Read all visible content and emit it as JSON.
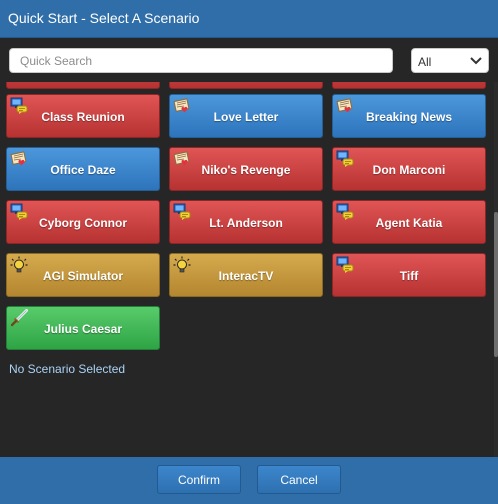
{
  "dialog": {
    "title": "Quick Start - Select A Scenario"
  },
  "search": {
    "placeholder": "Quick Search",
    "value": ""
  },
  "filter": {
    "selected": "All"
  },
  "scenarios": [
    {
      "name": "Class Reunion",
      "color": "red",
      "icon": "computer-chat-icon"
    },
    {
      "name": "Love Letter",
      "color": "blue",
      "icon": "letter-icon"
    },
    {
      "name": "Breaking News",
      "color": "blue",
      "icon": "letter-icon"
    },
    {
      "name": "Office Daze",
      "color": "blue",
      "icon": "letter-icon"
    },
    {
      "name": "Niko's Revenge",
      "color": "red",
      "icon": "letter-icon"
    },
    {
      "name": "Don Marconi",
      "color": "red",
      "icon": "computer-chat-icon"
    },
    {
      "name": "Cyborg Connor",
      "color": "red",
      "icon": "computer-chat-icon"
    },
    {
      "name": "Lt. Anderson",
      "color": "red",
      "icon": "computer-chat-icon"
    },
    {
      "name": "Agent Katia",
      "color": "red",
      "icon": "computer-chat-icon"
    },
    {
      "name": "AGI Simulator",
      "color": "gold",
      "icon": "lightbulb-icon"
    },
    {
      "name": "InteracTV",
      "color": "gold",
      "icon": "lightbulb-icon"
    },
    {
      "name": "Tiff",
      "color": "red",
      "icon": "computer-chat-icon"
    },
    {
      "name": "Julius Caesar",
      "color": "green",
      "icon": "sword-icon"
    }
  ],
  "status": {
    "text": "No Scenario Selected"
  },
  "footer": {
    "confirm_label": "Confirm",
    "cancel_label": "Cancel"
  }
}
